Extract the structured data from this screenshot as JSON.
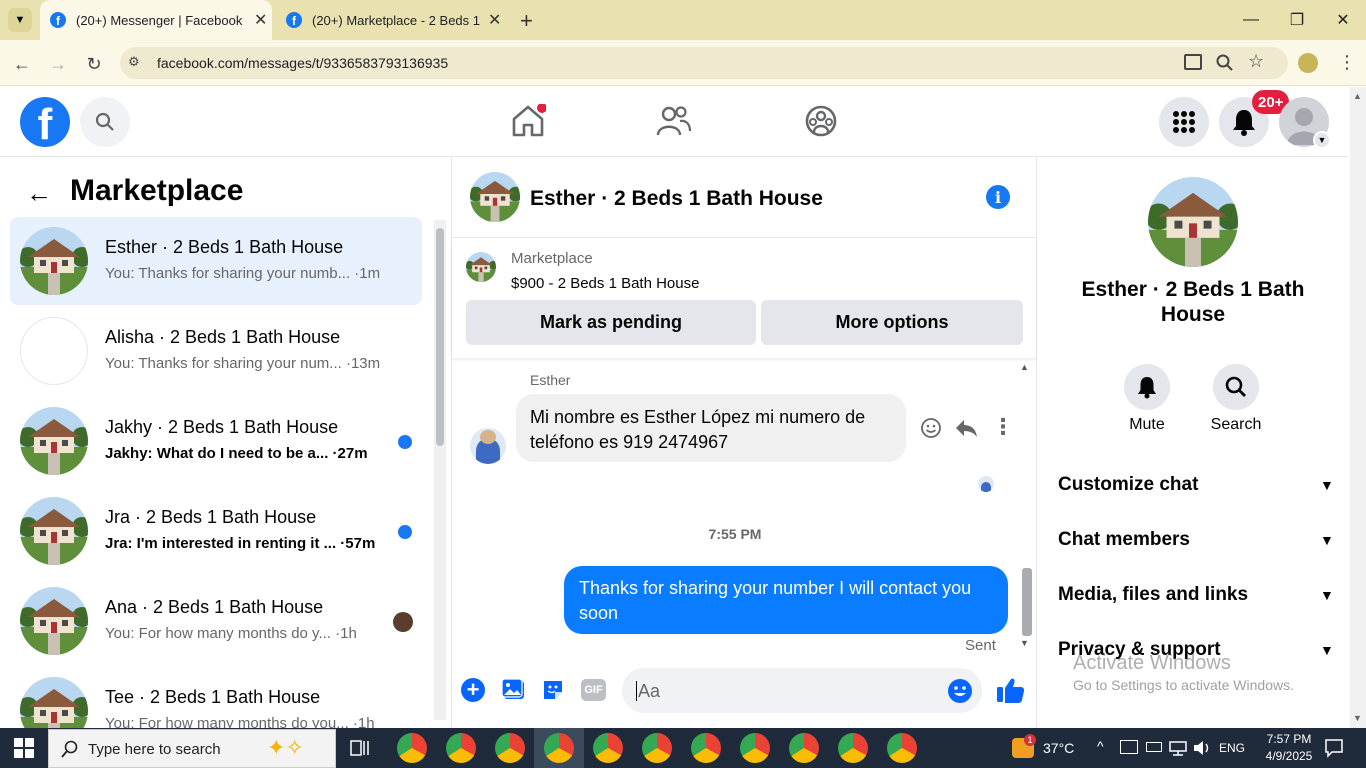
{
  "browser": {
    "tabs": [
      {
        "title": "(20+) Messenger | Facebook",
        "active": true
      },
      {
        "title": "(20+) Marketplace - 2 Beds 1 Bath",
        "active": false
      }
    ],
    "url": "facebook.com/messages/t/9336583793136935"
  },
  "fbnav": {
    "notifications_badge": "20+"
  },
  "sidebar": {
    "title": "Marketplace",
    "conversations": [
      {
        "name": "Esther · 2 Beds 1 Bath House",
        "preview": "You: Thanks for sharing your numb... ·1m",
        "unread": false,
        "selected": true
      },
      {
        "name": "Alisha · 2 Beds 1 Bath House",
        "preview": "You: Thanks for sharing your num... ·13m",
        "unread": false,
        "selected": false
      },
      {
        "name": "Jakhy · 2 Beds 1 Bath House",
        "preview": "Jakhy: What do I need to be a... ·27m",
        "unread": true,
        "selected": false
      },
      {
        "name": "Jra · 2 Beds 1 Bath House",
        "preview": "Jra: I'm interested in renting it ... ·57m",
        "unread": true,
        "selected": false
      },
      {
        "name": "Ana · 2 Beds 1 Bath House",
        "preview": "You: For how many months do y... ·1h",
        "unread": false,
        "selected": false
      },
      {
        "name": "Tee · 2 Beds 1 Bath House",
        "preview": "You: For how many months do you... ·1h",
        "unread": false,
        "selected": false
      }
    ]
  },
  "chat": {
    "header_title": "Esther · 2 Beds 1 Bath House",
    "listing": {
      "source": "Marketplace",
      "title": "$900 - 2 Beds 1 Bath House",
      "pending_button": "Mark as pending",
      "options_button": "More options"
    },
    "incoming_sender": "Esther",
    "incoming_text": "Mi nombre es Esther López mi numero de teléfono es 919 2474967",
    "timestamp": "7:55 PM",
    "outgoing_text": "Thanks for sharing your number I will contact you soon",
    "status": "Sent",
    "composer_placeholder": "Aa"
  },
  "details": {
    "name": "Esther · 2 Beds 1 Bath House",
    "mute_label": "Mute",
    "search_label": "Search",
    "sections": [
      "Customize chat",
      "Chat members",
      "Media, files and links",
      "Privacy & support"
    ]
  },
  "watermark": {
    "line1": "Activate Windows",
    "line2": "Go to Settings to activate Windows."
  },
  "taskbar": {
    "search_placeholder": "Type here to search",
    "weather": "37°C",
    "lang": "ENG",
    "time": "7:57 PM",
    "date": "4/9/2025",
    "weather_badge": "1"
  },
  "colors": {
    "fb_blue": "#1877f2",
    "selected_bg": "#e7f1fe",
    "chrome_tab": "#e9e2b0",
    "taskbar": "#1f2a3a"
  }
}
